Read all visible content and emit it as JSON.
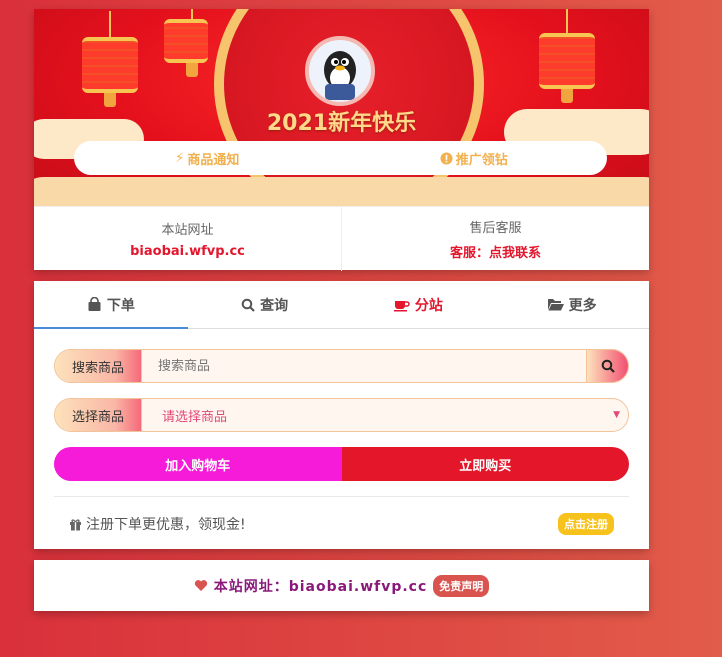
{
  "banner": {
    "title": "2021新年快乐",
    "pill": {
      "notice_label": "商品通知",
      "promo_label": "推广领钻"
    }
  },
  "info": {
    "site_label": "本站网址",
    "site_value": "biaobai.wfvp.cc",
    "service_label": "售后客服",
    "service_value": "客服：点我联系"
  },
  "tabs": [
    {
      "label": "下单",
      "icon": "shopping-bag-icon"
    },
    {
      "label": "查询",
      "icon": "search-icon"
    },
    {
      "label": "分站",
      "icon": "coffee-cup-icon"
    },
    {
      "label": "更多",
      "icon": "folder-open-icon"
    }
  ],
  "form": {
    "search_label": "搜索商品",
    "search_placeholder": "搜索商品",
    "select_label": "选择商品",
    "select_value": "请选择商品",
    "cart_button": "加入购物车",
    "buy_button": "立即购买"
  },
  "promo": {
    "text": "注册下单更优惠，领现金!",
    "register_badge": "点击注册"
  },
  "footer": {
    "text": "本站网址：biaobai.wfvp.cc",
    "disclaimer": "免责声明"
  },
  "colors": {
    "accent_red": "#e3162d",
    "cart_pink": "#f51bd8",
    "register_yellow": "#f8c21c"
  }
}
